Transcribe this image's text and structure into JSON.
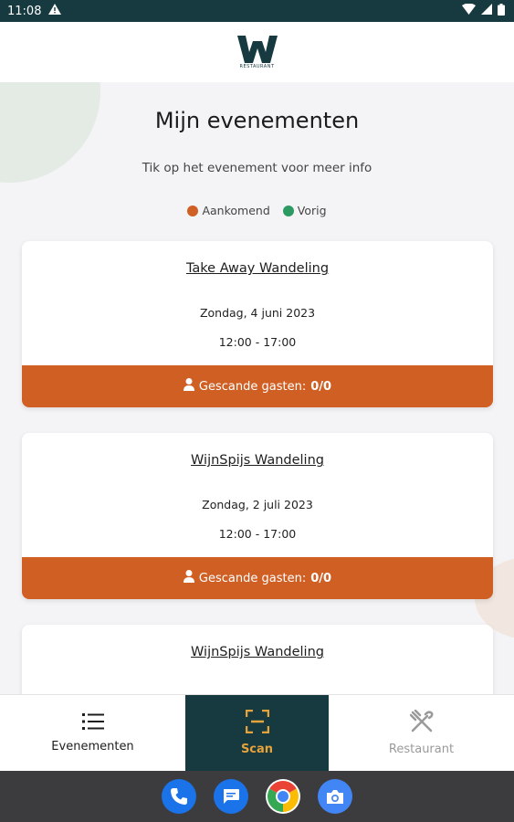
{
  "status_bar": {
    "time": "11:08"
  },
  "header": {
    "logo_letter": "W",
    "logo_sub": "RESTAURANT"
  },
  "page": {
    "title": "Mijn evenementen",
    "subtitle": "Tik op het evenement voor meer info"
  },
  "legend": [
    {
      "label": "Aankomend",
      "color": "#d05f24"
    },
    {
      "label": "Vorig",
      "color": "#2e9a63"
    }
  ],
  "events": [
    {
      "title": "Take Away Wandeling",
      "date": "Zondag, 4 juni 2023",
      "time": "12:00 - 17:00",
      "guests_label": "Gescande gasten:",
      "guests": "0/0"
    },
    {
      "title": "WijnSpijs Wandeling",
      "date": "Zondag, 2 juli 2023",
      "time": "12:00 - 17:00",
      "guests_label": "Gescande gasten:",
      "guests": "0/0"
    },
    {
      "title": "WijnSpijs Wandeling"
    }
  ],
  "nav": {
    "events_label": "Evenementen",
    "scan_label": "Scan",
    "restaurant_label": "Restaurant"
  },
  "colors": {
    "brand_dark": "#163a40",
    "accent_orange": "#d05f24",
    "scan_gold": "#e6a33a",
    "past_green": "#2e9a63"
  }
}
